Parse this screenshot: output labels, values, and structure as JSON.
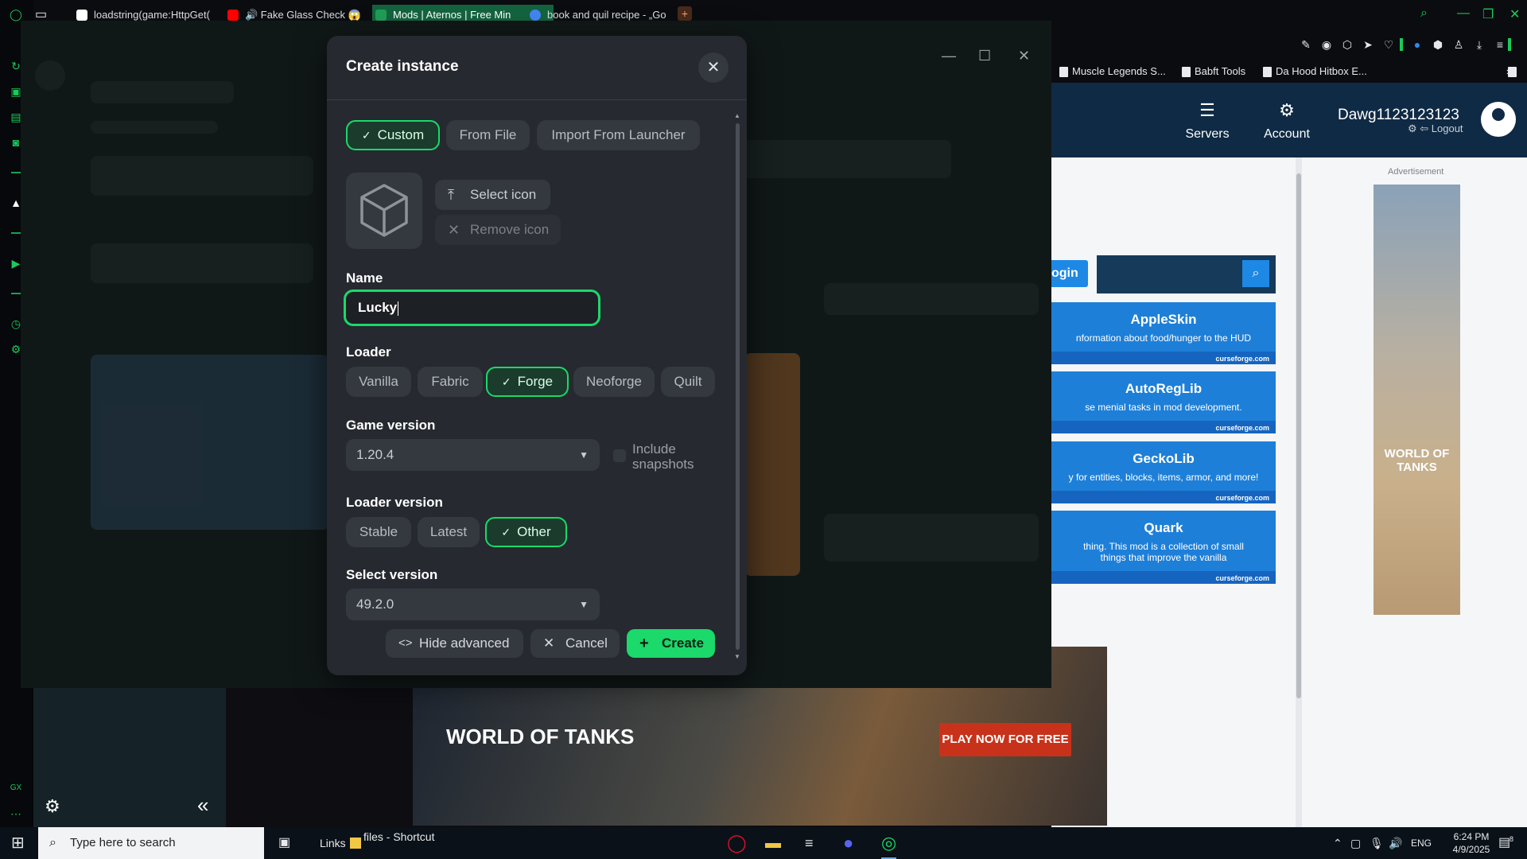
{
  "browser": {
    "tabs": [
      {
        "label": "loadstring(game:HttpGet(",
        "color": "#ffffff"
      },
      {
        "label": "🔊 Fake Glass Check 😱",
        "color": "#ff0000"
      },
      {
        "label": "Mods | Aternos | Free Min",
        "color": "#1f9d55"
      },
      {
        "label": "book and quil recipe - „Go",
        "color": "#4285f4"
      }
    ],
    "bookmarks": [
      "Muscle Legends S...",
      "Babft Tools",
      "Da Hood Hitbox E..."
    ]
  },
  "site": {
    "nav": {
      "servers": "Servers",
      "account": "Account"
    },
    "username": "Dawg1123123123",
    "logout": "Logout",
    "login": "ogin",
    "ad_label": "Advertisement",
    "mods": [
      {
        "title": "AppleSkin",
        "desc": "nformation about food/hunger to the HUD",
        "source": "curseforge.com"
      },
      {
        "title": "AutoRegLib",
        "desc": "se menial tasks in mod development.",
        "source": "curseforge.com"
      },
      {
        "title": "GeckoLib",
        "desc": "y for entities, blocks, items, armor, and more!",
        "source": "curseforge.com"
      },
      {
        "title": "Quark",
        "desc": "thing. This mod is a collection of small things that improve the vanilla",
        "source": "curseforge.com"
      }
    ],
    "ad_tall_text": "WORLD OF TANKS",
    "ad_bottom": {
      "brand": "WORLD OF TANKS",
      "cta": "PLAY NOW FOR FREE"
    }
  },
  "modal": {
    "title": "Create instance",
    "source_tabs": [
      "Custom",
      "From File",
      "Import From Launcher"
    ],
    "selected_source": "Custom",
    "select_icon": "Select icon",
    "remove_icon": "Remove icon",
    "name_label": "Name",
    "name_value": "Lucky",
    "loader_label": "Loader",
    "loaders": [
      "Vanilla",
      "Fabric",
      "Forge",
      "Neoforge",
      "Quilt"
    ],
    "selected_loader": "Forge",
    "game_version_label": "Game version",
    "game_version": "1.20.4",
    "include_snapshots": "Include snapshots",
    "loader_version_label": "Loader version",
    "loader_versions": [
      "Stable",
      "Latest",
      "Other"
    ],
    "selected_loader_version": "Other",
    "select_version_label": "Select version",
    "select_version": "49.2.0",
    "hide_advanced": "Hide advanced",
    "cancel": "Cancel",
    "create": "Create"
  },
  "taskbar": {
    "search_placeholder": "Type here to search",
    "links": "Links",
    "shortcut": "files - Shortcut",
    "lang": "ENG",
    "time": "6:24 PM",
    "date": "4/9/2025",
    "notif_count": "8"
  },
  "colors": {
    "accent": "#1bd96a",
    "modal_bg": "#26292f",
    "chip_bg": "#34383f"
  }
}
